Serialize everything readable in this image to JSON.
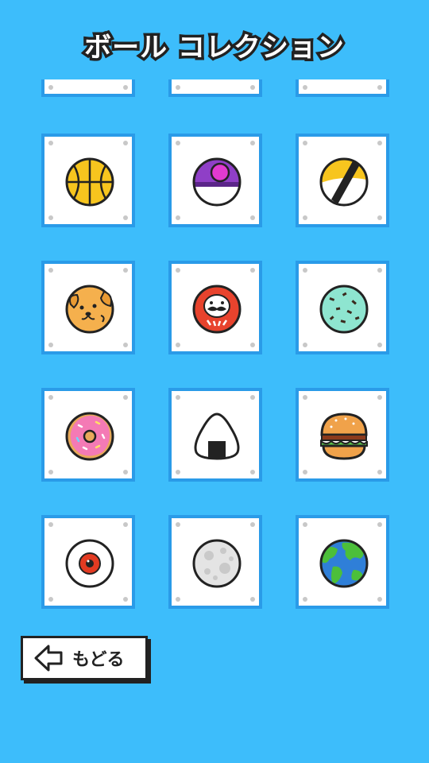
{
  "header": {
    "title": "ボール コレクション"
  },
  "grid": {
    "partial_row": [
      {
        "ball": "blank"
      },
      {
        "ball": "blank"
      },
      {
        "ball": "blank"
      }
    ],
    "items": [
      {
        "ball": "basketball"
      },
      {
        "ball": "purple-capsule-ball"
      },
      {
        "ball": "yellow-black-stripe-ball"
      },
      {
        "ball": "dog-face-ball"
      },
      {
        "ball": "daruma-ball"
      },
      {
        "ball": "mint-chocolate-ball"
      },
      {
        "ball": "pink-donut-ball"
      },
      {
        "ball": "onigiri-ball"
      },
      {
        "ball": "hamburger-ball"
      },
      {
        "ball": "eyeball-ball"
      },
      {
        "ball": "moon-ball"
      },
      {
        "ball": "earth-ball"
      }
    ]
  },
  "footer": {
    "back_label": "もどる",
    "back_icon": "arrow-left-icon"
  },
  "colors": {
    "background": "#3dbdfb",
    "frame_border": "#2a9be8",
    "frame_fill": "#ffffff"
  }
}
